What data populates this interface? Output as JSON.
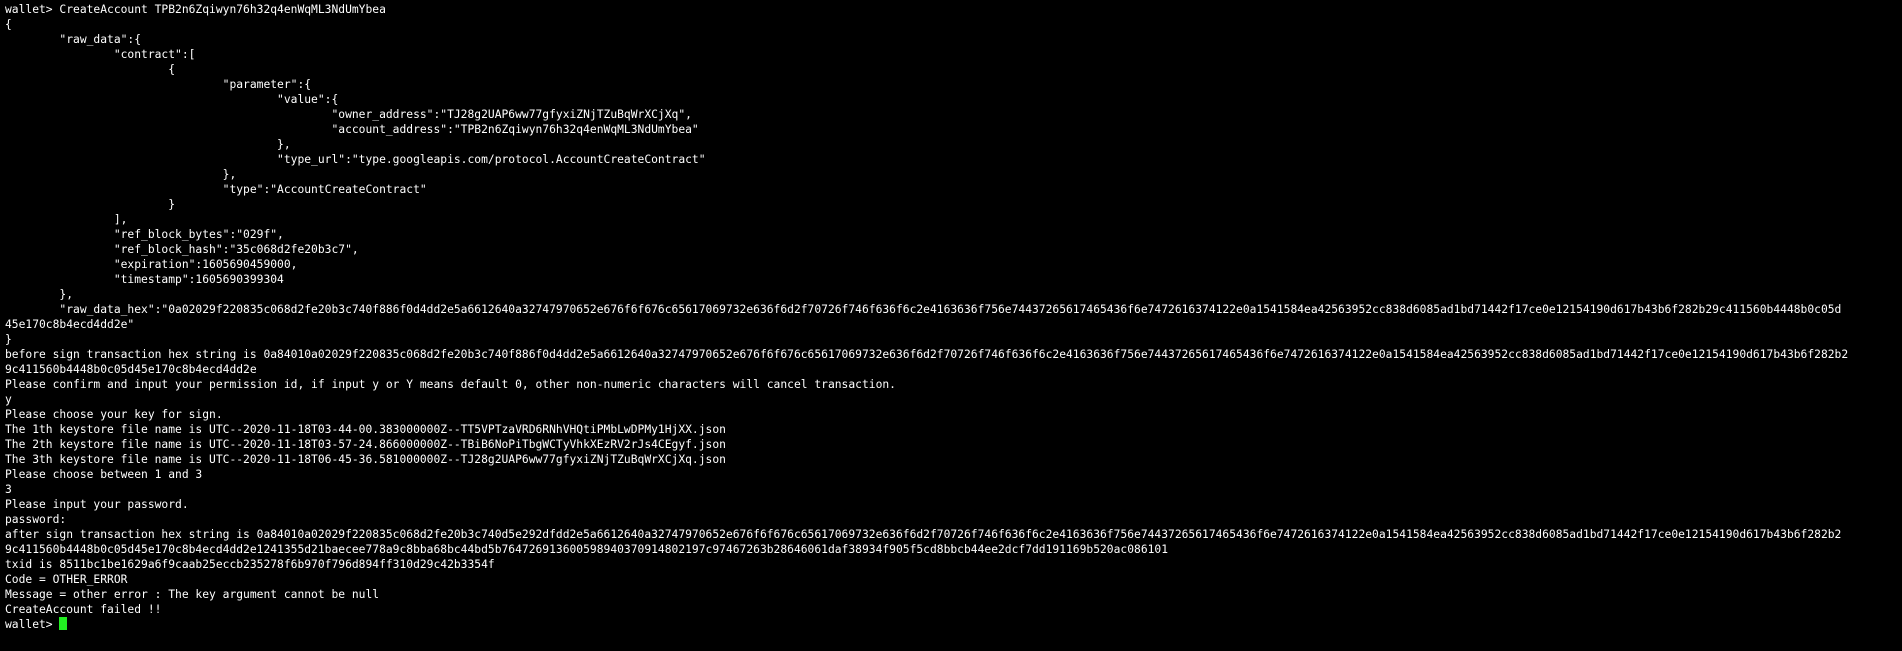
{
  "terminal": {
    "lines": [
      "wallet> CreateAccount TPB2n6Zqiwyn76h32q4enWqML3NdUmYbea",
      "{",
      "        \"raw_data\":{",
      "                \"contract\":[",
      "                        {",
      "                                \"parameter\":{",
      "                                        \"value\":{",
      "                                                \"owner_address\":\"TJ28g2UAP6ww77gfyxiZNjTZuBqWrXCjXq\",",
      "                                                \"account_address\":\"TPB2n6Zqiwyn76h32q4enWqML3NdUmYbea\"",
      "                                        },",
      "                                        \"type_url\":\"type.googleapis.com/protocol.AccountCreateContract\"",
      "                                },",
      "                                \"type\":\"AccountCreateContract\"",
      "                        }",
      "                ],",
      "                \"ref_block_bytes\":\"029f\",",
      "                \"ref_block_hash\":\"35c068d2fe20b3c7\",",
      "                \"expiration\":1605690459000,",
      "                \"timestamp\":1605690399304",
      "        },",
      "        \"raw_data_hex\":\"0a02029f220835c068d2fe20b3c740f886f0d4dd2e5a6612640a32747970652e676f6f676c65617069732e636f6d2f70726f746f636f6c2e4163636f756e74437265617465436f6e7472616374122e0a1541584ea42563952cc838d6085ad1bd71442f17ce0e12154190d617b43b6f282b29c411560b4448b0c05d",
      "45e170c8b4ecd4dd2e\"",
      "}",
      "before sign transaction hex string is 0a84010a02029f220835c068d2fe20b3c740f886f0d4dd2e5a6612640a32747970652e676f6f676c65617069732e636f6d2f70726f746f636f6c2e4163636f756e74437265617465436f6e7472616374122e0a1541584ea42563952cc838d6085ad1bd71442f17ce0e12154190d617b43b6f282b2",
      "9c411560b4448b0c05d45e170c8b4ecd4dd2e",
      "Please confirm and input your permission id, if input y or Y means default 0, other non-numeric characters will cancel transaction.",
      "y",
      "Please choose your key for sign.",
      "The 1th keystore file name is UTC--2020-11-18T03-44-00.383000000Z--TT5VPTzaVRD6RNhVHQtiPMbLwDPMy1HjXX.json",
      "The 2th keystore file name is UTC--2020-11-18T03-57-24.866000000Z--TBiB6NoPiTbgWCTyVhkXEzRV2rJs4CEgyf.json",
      "The 3th keystore file name is UTC--2020-11-18T06-45-36.581000000Z--TJ28g2UAP6ww77gfyxiZNjTZuBqWrXCjXq.json",
      "Please choose between 1 and 3",
      "3",
      "Please input your password.",
      "password:",
      "after sign transaction hex string is 0a84010a02029f220835c068d2fe20b3c740d5e292dfdd2e5a6612640a32747970652e676f6f676c65617069732e636f6d2f70726f746f636f6c2e4163636f756e74437265617465436f6e7472616374122e0a1541584ea42563952cc838d6085ad1bd71442f17ce0e12154190d617b43b6f282b2",
      "9c411560b4448b0c05d45e170c8b4ecd4dd2e1241355d21baecee778a9c8bba68bc44bd5b764726913600598940370914802197c97467263b28646061daf38934f905f5cd8bbcb44ee2dcf7dd191169b520ac086101",
      "txid is 8511bc1be1629a6f9caab25eccb235278f6b970f796d894ff310d29c42b3354f",
      "Code = OTHER_ERROR",
      "Message = other error : The key argument cannot be null",
      "CreateAccount failed !!"
    ],
    "prompt": "wallet> "
  },
  "colors": {
    "background": "#000000",
    "text": "#ffffff",
    "cursor": "#22ee22"
  }
}
